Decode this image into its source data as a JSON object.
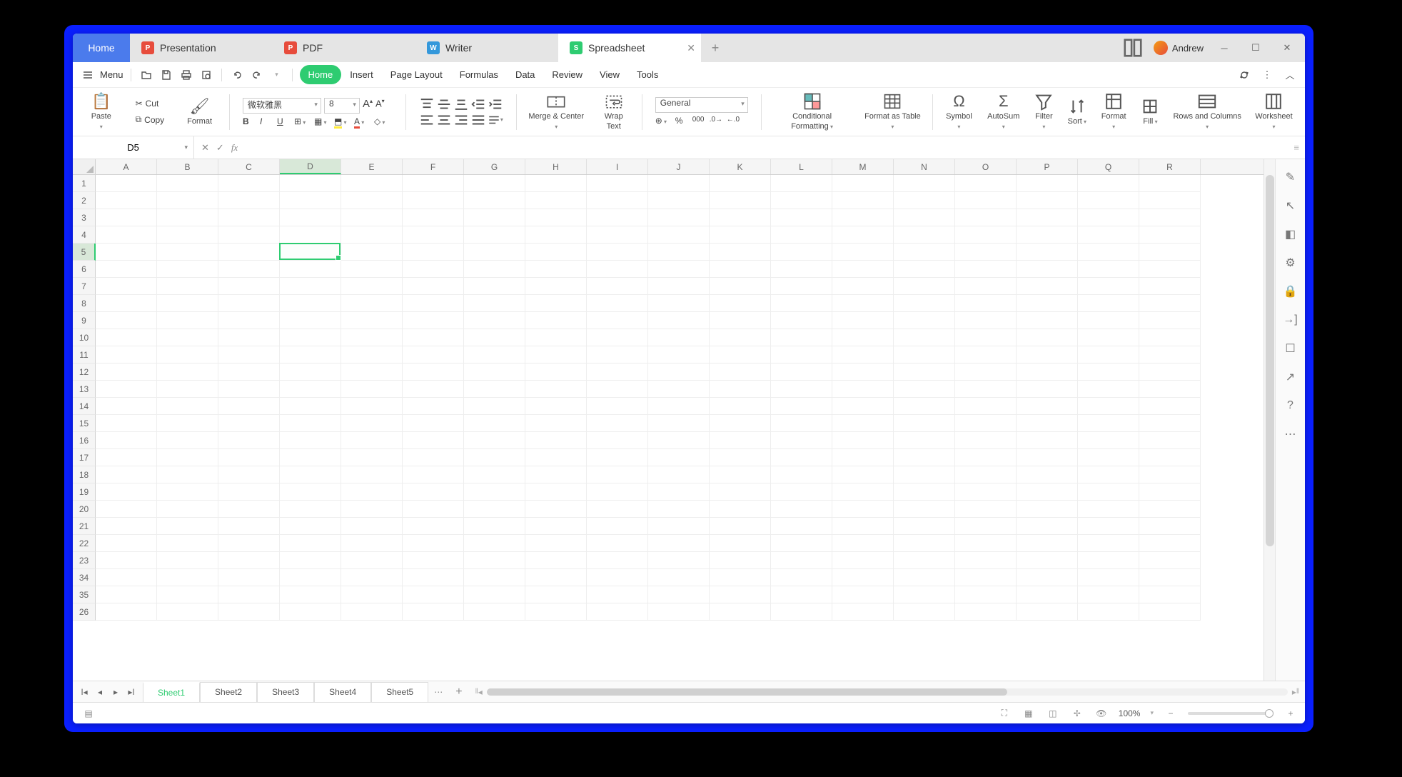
{
  "titlebar": {
    "home": "Home",
    "tabs": [
      {
        "icon": "p",
        "iconLetter": "P",
        "label": "Presentation"
      },
      {
        "icon": "pdf",
        "iconLetter": "P",
        "label": "PDF"
      },
      {
        "icon": "w",
        "iconLetter": "W",
        "label": "Writer"
      },
      {
        "icon": "s",
        "iconLetter": "S",
        "label": "Spreadsheet",
        "active": true,
        "closable": true
      }
    ],
    "user": "Andrew"
  },
  "menubar": {
    "menu": "Menu",
    "items": [
      "Home",
      "Insert",
      "Page Layout",
      "Formulas",
      "Data",
      "Review",
      "View",
      "Tools"
    ],
    "active": "Home"
  },
  "ribbon": {
    "paste": "Paste",
    "cut": "Cut",
    "copy": "Copy",
    "format": "Format",
    "font": "微软雅黑",
    "fontSize": "8",
    "merge": "Merge & Center",
    "wrap": "Wrap Text",
    "numFmt": "General",
    "condFmt": "Conditional Formatting",
    "fmtTable": "Format as Table",
    "symbol": "Symbol",
    "autosum": "AutoSum",
    "filter": "Filter",
    "sort": "Sort",
    "formatBtn": "Format",
    "fill": "Fill",
    "rowscols": "Rows and Columns",
    "worksheet": "Worksheet"
  },
  "formula": {
    "cellRef": "D5",
    "value": ""
  },
  "grid": {
    "cols": [
      "A",
      "B",
      "C",
      "D",
      "E",
      "F",
      "G",
      "H",
      "I",
      "J",
      "K",
      "L",
      "M",
      "N",
      "O",
      "P",
      "Q",
      "R"
    ],
    "rows": [
      1,
      2,
      3,
      4,
      5,
      6,
      7,
      8,
      9,
      10,
      11,
      12,
      13,
      14,
      15,
      16,
      17,
      18,
      19,
      20,
      21,
      22,
      23,
      34,
      35,
      26
    ],
    "selectedCol": "D",
    "selectedRow": 5
  },
  "sheets": {
    "tabs": [
      "Sheet1",
      "Sheet2",
      "Sheet3",
      "Sheet4",
      "Sheet5"
    ],
    "active": "Sheet1"
  },
  "status": {
    "zoom": "100%"
  }
}
